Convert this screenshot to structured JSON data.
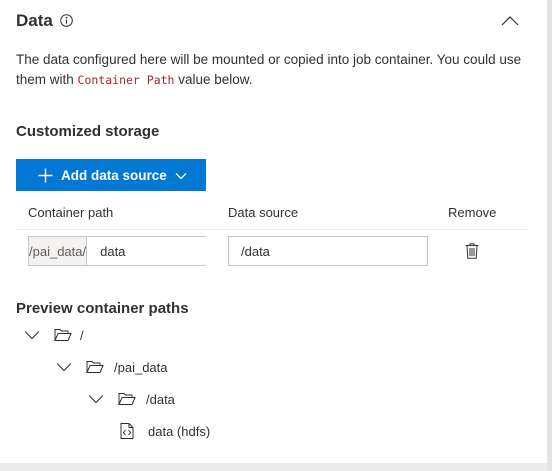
{
  "section": {
    "title": "Data",
    "icons": {
      "info": "info-icon",
      "collapse": "chevron-up-icon"
    }
  },
  "description": {
    "before": "The data configured here will be mounted or copied into job container. You could use them with ",
    "code": "Container Path",
    "after": " value below."
  },
  "storage": {
    "title": "Customized storage",
    "add_button_label": "Add data source",
    "columns": {
      "container_path": "Container path",
      "data_source": "Data source",
      "remove": "Remove"
    },
    "rows": [
      {
        "prefix": "/pai_data/",
        "container_path": "data",
        "data_source": "/data"
      }
    ]
  },
  "preview": {
    "title": "Preview container paths",
    "tree": [
      {
        "label": "/",
        "icon": "folder-open-icon"
      },
      {
        "label": "/pai_data",
        "icon": "folder-open-icon"
      },
      {
        "label": "/data",
        "icon": "folder-open-icon"
      },
      {
        "label": "data (hdfs)",
        "icon": "file-code-icon"
      }
    ]
  },
  "colors": {
    "accent": "#0078d4",
    "code": "#a4262c",
    "text": "#323130"
  }
}
